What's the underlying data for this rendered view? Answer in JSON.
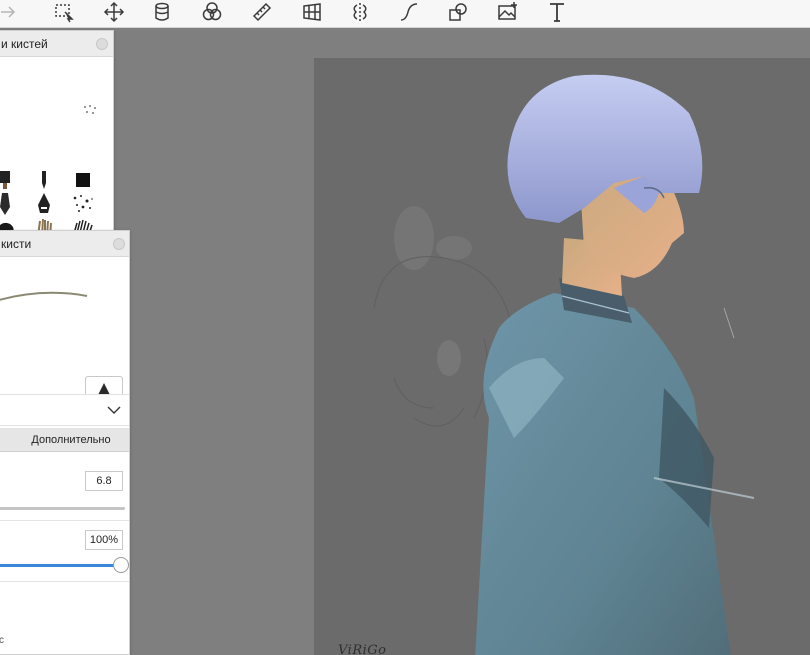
{
  "toolbar": {
    "tools": [
      {
        "icon": "redo-arrow-icon"
      },
      {
        "icon": "selection-icon"
      },
      {
        "icon": "transform-move-icon"
      },
      {
        "icon": "fill-bucket-icon"
      },
      {
        "icon": "color-blend-icon"
      },
      {
        "icon": "ruler-icon"
      },
      {
        "icon": "perspective-grid-icon"
      },
      {
        "icon": "symmetry-icon"
      },
      {
        "icon": "curve-icon"
      },
      {
        "icon": "shapes-icon"
      },
      {
        "icon": "image-import-icon"
      },
      {
        "icon": "text-tool-icon"
      }
    ]
  },
  "brush_library": {
    "title": "я кистей",
    "title_visible": "и кистей"
  },
  "brush_settings": {
    "title": "кисти",
    "advanced_label": "Дополнительно",
    "size_value": "6.8",
    "opacity_value": "100%",
    "opacity_fraction": 1.0,
    "footer": "с"
  },
  "canvas": {
    "signature": "ViRiGo"
  },
  "colors": {
    "toolbar_bg": "#f7f7f7",
    "workspace_bg": "#7f7f7f",
    "canvas_bg": "#6b6b6b",
    "hair": "#b7bfe8",
    "accent_slider": "#3a86d8"
  }
}
